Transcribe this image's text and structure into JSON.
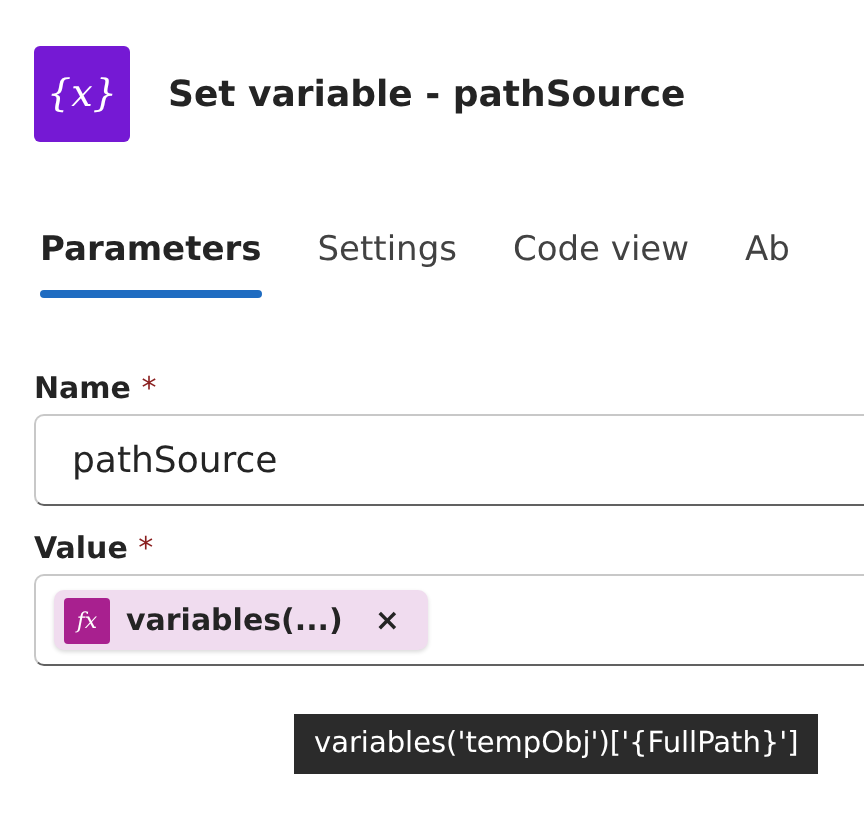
{
  "header": {
    "icon_text": "{x}",
    "title": "Set variable - pathSource"
  },
  "tabs": [
    {
      "label": "Parameters",
      "selected": true
    },
    {
      "label": "Settings",
      "selected": false
    },
    {
      "label": "Code view",
      "selected": false
    },
    {
      "label": "Ab",
      "selected": false
    }
  ],
  "fields": [
    {
      "kind": "text",
      "label": "Name",
      "required_mark": "*",
      "value": "pathSource"
    },
    {
      "kind": "tokens",
      "label": "Value",
      "required_mark": "*",
      "tokens": [
        {
          "icon_text": "fx",
          "label": "variables(...)",
          "remove": "×"
        }
      ]
    }
  ],
  "tooltip": "variables('tempObj')['{FullPath}']"
}
